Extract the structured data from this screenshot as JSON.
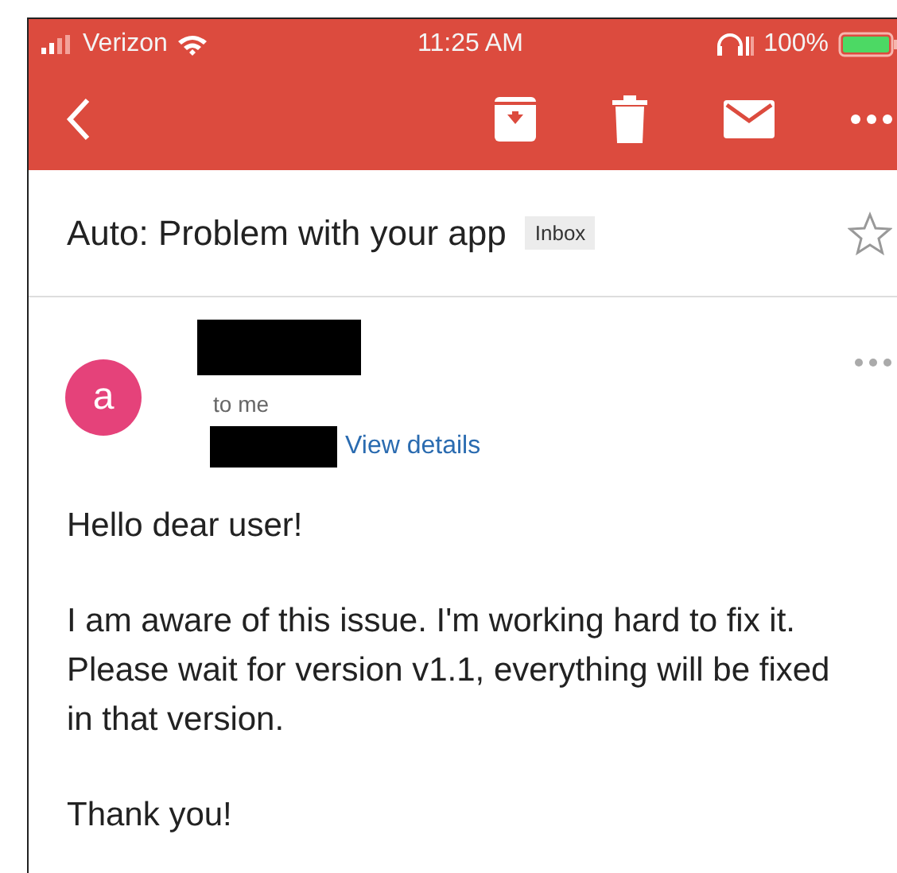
{
  "status_bar": {
    "carrier": "Verizon",
    "time": "11:25 AM",
    "battery": "100%"
  },
  "toolbar": {
    "actions": [
      {
        "kind": "archive"
      },
      {
        "kind": "delete"
      },
      {
        "kind": "mail"
      },
      {
        "kind": "more"
      }
    ]
  },
  "subject": {
    "title": "Auto: Problem with your app",
    "label": "Inbox",
    "starred": false
  },
  "message": {
    "avatar_letter": "a",
    "recipient": "to me",
    "details_link": "View details",
    "body": [
      "Hello dear user!",
      "I am aware of this issue. I'm working hard to fix it. Please wait for version v1.1, everything will be fixed in that version.",
      "Thank you!"
    ]
  }
}
